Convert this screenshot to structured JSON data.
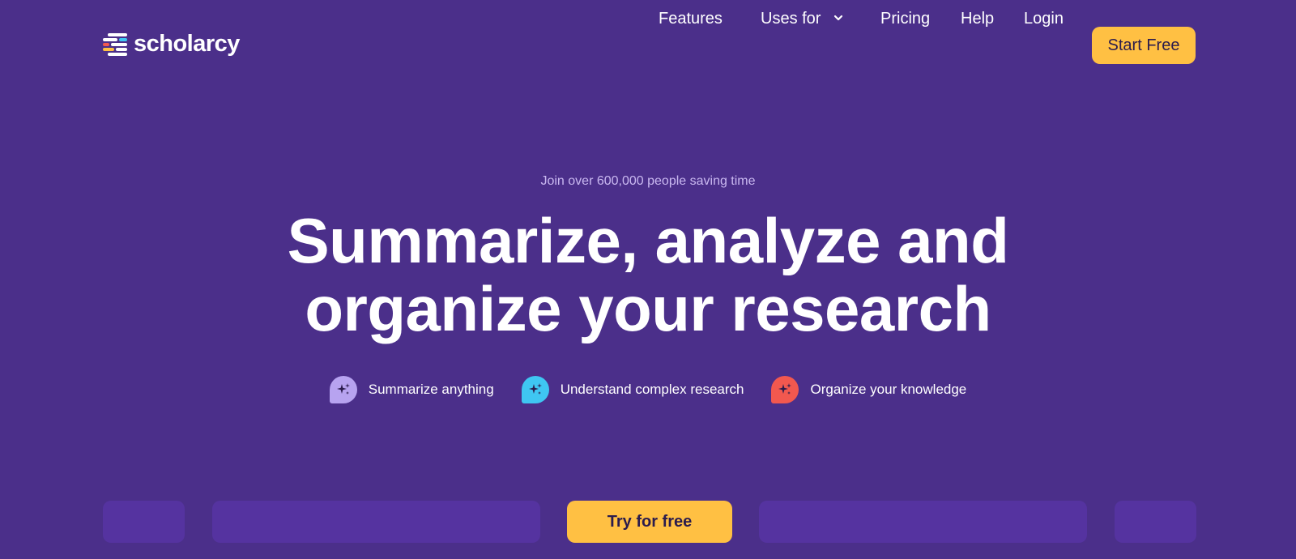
{
  "brand": {
    "name": "scholarcy",
    "logo_icon": "stacked-bars-logo-icon"
  },
  "nav": {
    "features": "Features",
    "uses_for": "Uses for",
    "uses_for_icon": "chevron-down-icon",
    "pricing": "Pricing",
    "help": "Help",
    "login": "Login",
    "start_free": "Start Free"
  },
  "hero": {
    "eyebrow": "Join over 600,000 people saving time",
    "headline_line1": "Summarize, analyze and",
    "headline_line2": "organize your research",
    "features": [
      {
        "label": "Summarize anything",
        "icon": "sparkle-bubble-icon",
        "color": "#b7a3f0"
      },
      {
        "label": "Understand complex research",
        "icon": "sparkle-bubble-icon",
        "color": "#3fc6f2"
      },
      {
        "label": "Organize your knowledge",
        "icon": "sparkle-bubble-icon",
        "color": "#f2584f"
      }
    ]
  },
  "cta": {
    "try_free": "Try for free"
  },
  "colors": {
    "background": "#4b2f8a",
    "accent": "#ffc043",
    "placeholder": "#5533a0"
  }
}
